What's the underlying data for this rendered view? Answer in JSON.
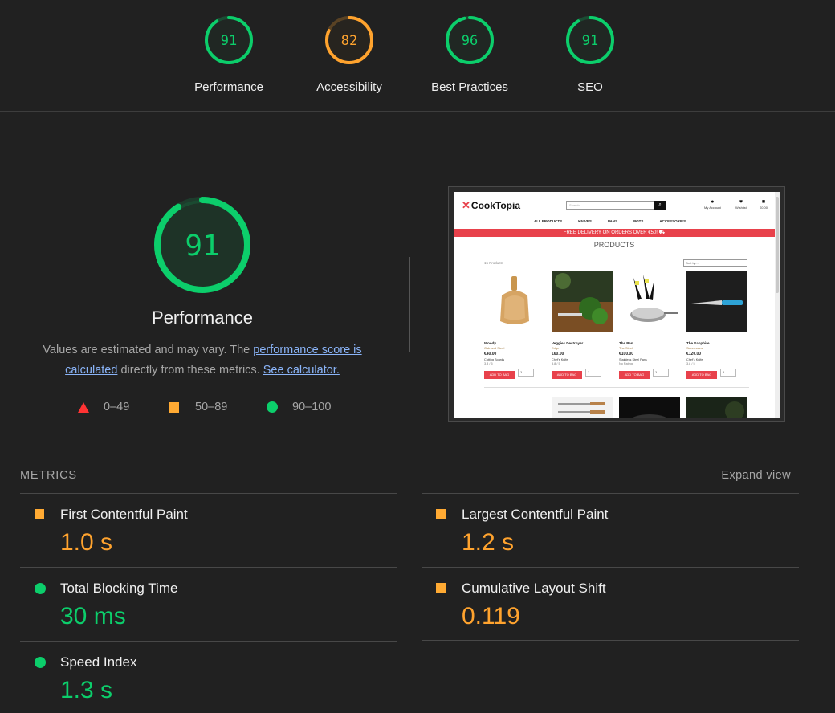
{
  "colors": {
    "pass": "#0cce6b",
    "average": "#ffa32e",
    "fail": "#ff3333",
    "background": "#212121"
  },
  "scores": [
    {
      "label": "Performance",
      "value": "91",
      "status": "pass"
    },
    {
      "label": "Accessibility",
      "value": "82",
      "status": "average"
    },
    {
      "label": "Best Practices",
      "value": "96",
      "status": "pass"
    },
    {
      "label": "SEO",
      "value": "91",
      "status": "pass"
    }
  ],
  "hero": {
    "score": "91",
    "title": "Performance",
    "desc_prefix": "Values are estimated and may vary. The ",
    "desc_link1": "performance score is calculated",
    "desc_mid": " directly from these metrics. ",
    "desc_link2": "See calculator.",
    "legend": [
      {
        "icon": "triangle-icon",
        "range": "0–49"
      },
      {
        "icon": "square-icon",
        "range": "50–89"
      },
      {
        "icon": "circle-icon",
        "range": "90–100"
      }
    ]
  },
  "screenshot": {
    "logo": "CookTopia",
    "search_placeholder": "Search",
    "account": "My Account",
    "wishlist": "Wishlist",
    "bag": "€0.00",
    "nav": [
      "ALL PRODUCTS",
      "KNIVES",
      "PANS",
      "POTS",
      "ACCESSORIES"
    ],
    "banner": "FREE DELIVERY ON ORDERS OVER €50! ⛟",
    "heading": "PRODUCTS",
    "count": "15 Products",
    "sort": "Sort by...",
    "products": [
      {
        "name": "Woody",
        "sub": "Oak and Steel",
        "price": "€40.00",
        "tag": "Cutting Boards",
        "rating": "3.8 / 5"
      },
      {
        "name": "Veggies Destroyer",
        "sub": "Edge",
        "price": "€60.00",
        "tag": "Chef's Knife",
        "rating": "3.8 / 5"
      },
      {
        "name": "The Pan",
        "sub": "The Steel",
        "price": "€100.00",
        "tag": "Stainless Steel Pans",
        "rating": "No Rating"
      },
      {
        "name": "The Sapphire",
        "sub": "Savemates",
        "price": "€120.00",
        "tag": "Chef's Knife",
        "rating": "3.8 / 5"
      }
    ],
    "add_label": "ADD TO BAG",
    "qty": "1"
  },
  "metrics": {
    "header": "METRICS",
    "expand": "Expand view",
    "items": [
      {
        "name": "First Contentful Paint",
        "value": "1.0 s",
        "status": "average"
      },
      {
        "name": "Largest Contentful Paint",
        "value": "1.2 s",
        "status": "average"
      },
      {
        "name": "Total Blocking Time",
        "value": "30 ms",
        "status": "pass"
      },
      {
        "name": "Cumulative Layout Shift",
        "value": "0.119",
        "status": "average"
      },
      {
        "name": "Speed Index",
        "value": "1.3 s",
        "status": "pass"
      }
    ]
  }
}
